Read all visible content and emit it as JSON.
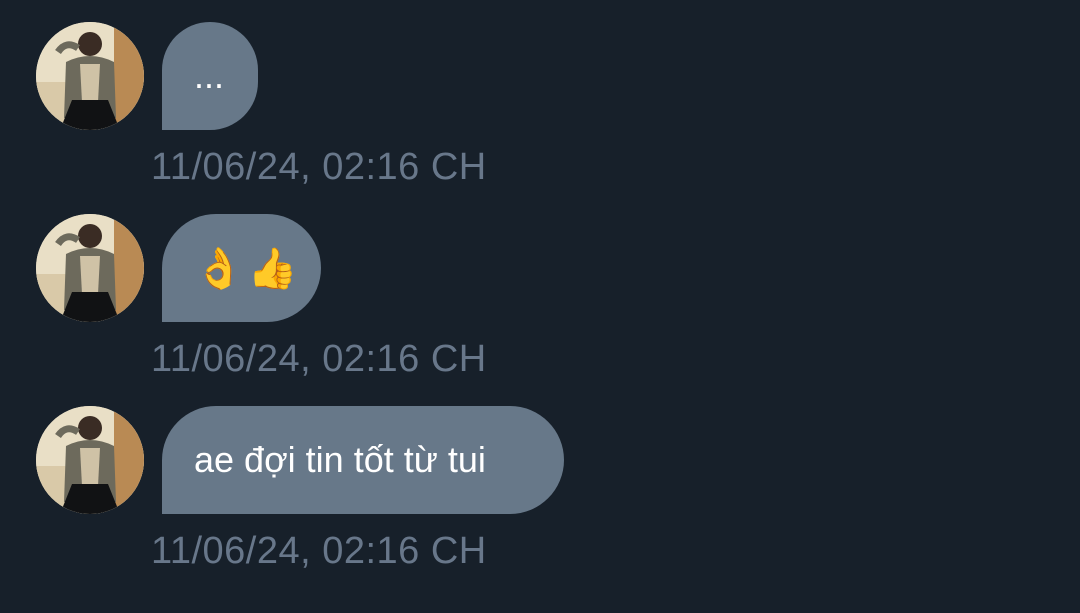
{
  "messages": [
    {
      "text": "...",
      "timestamp": "11/06/24, 02:16 CH",
      "avatar_icon": "user-avatar-photo"
    },
    {
      "text": "👌👍",
      "timestamp": "11/06/24, 02:16 CH",
      "avatar_icon": "user-avatar-photo"
    },
    {
      "text": "ae đợi tin tốt từ tui",
      "timestamp": "11/06/24, 02:16 CH",
      "avatar_icon": "user-avatar-photo"
    }
  ],
  "colors": {
    "background": "#17202a",
    "bubble": "#677889",
    "bubble_text": "#ffffff",
    "timestamp": "#68778a"
  }
}
